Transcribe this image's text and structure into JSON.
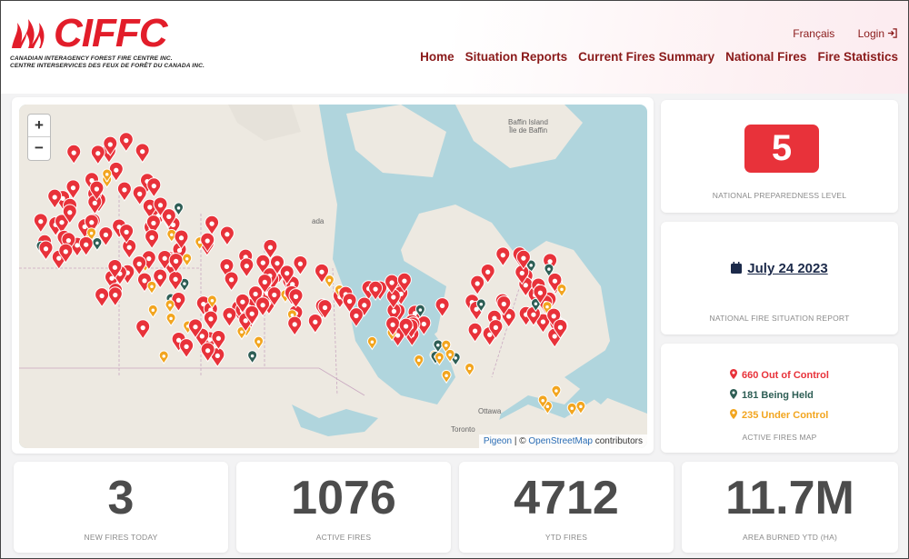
{
  "header": {
    "logo_text": "CIFFC",
    "logo_sub_en": "CANADIAN INTERAGENCY FOREST FIRE CENTRE INC.",
    "logo_sub_fr": "CENTRE INTERSERVICES DES FEUX DE FORÊT DU CANADA INC.",
    "lang_link": "Français",
    "login_link": "Login",
    "nav": [
      "Home",
      "Situation Reports",
      "Current Fires Summary",
      "National Fires",
      "Fire Statistics"
    ]
  },
  "map": {
    "zoom_in": "+",
    "zoom_out": "−",
    "labels": {
      "baffin_en": "Baffin Island",
      "baffin_fr": "Île de Baffin",
      "ottawa": "Ottawa",
      "toronto": "Toronto",
      "ada": "ada"
    },
    "attribution": {
      "pigeon": "Pigeon",
      "sep": " | © ",
      "osm": "OpenStreetMap",
      "contrib": " contributors"
    }
  },
  "preparedness": {
    "level": "5",
    "caption": "NATIONAL PREPAREDNESS LEVEL"
  },
  "report": {
    "date": "July 24 2023",
    "caption": "NATIONAL FIRE SITUATION REPORT"
  },
  "active_map": {
    "out_of_control": "660 Out of Control",
    "being_held": "181 Being Held",
    "under_control": "235 Under Control",
    "caption": "ACTIVE FIRES MAP",
    "colors": {
      "out_of_control": "#e8323a",
      "being_held": "#2e5e55",
      "under_control": "#f2a51f"
    }
  },
  "stats": [
    {
      "value": "3",
      "label": "NEW FIRES TODAY"
    },
    {
      "value": "1076",
      "label": "ACTIVE FIRES"
    },
    {
      "value": "4712",
      "label": "YTD FIRES"
    },
    {
      "value": "11.7M",
      "label": "AREA BURNED YTD (HA)"
    }
  ]
}
